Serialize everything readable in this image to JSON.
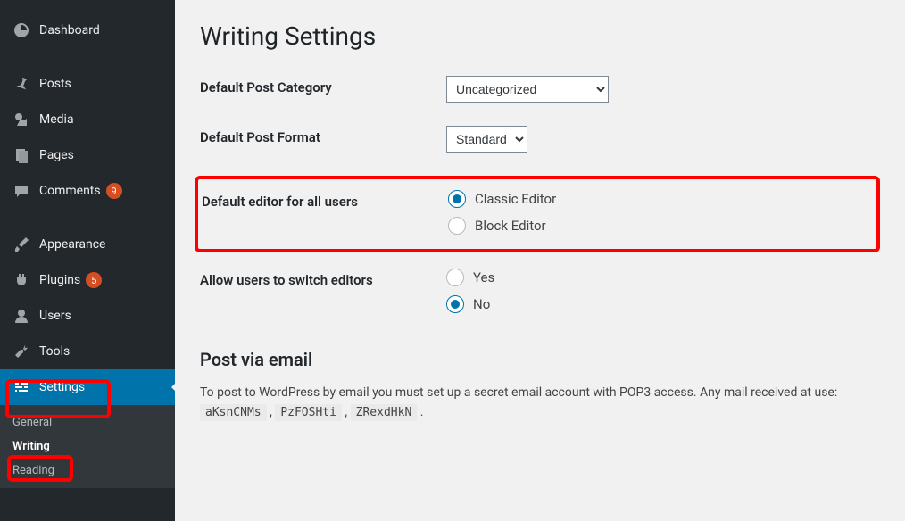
{
  "sidebar": {
    "items": [
      {
        "label": "Dashboard"
      },
      {
        "label": "Posts"
      },
      {
        "label": "Media"
      },
      {
        "label": "Pages"
      },
      {
        "label": "Comments",
        "badge": "9"
      },
      {
        "label": "Appearance"
      },
      {
        "label": "Plugins",
        "badge": "5"
      },
      {
        "label": "Users"
      },
      {
        "label": "Tools"
      },
      {
        "label": "Settings"
      }
    ],
    "submenu": [
      {
        "label": "General"
      },
      {
        "label": "Writing"
      },
      {
        "label": "Reading"
      }
    ]
  },
  "page": {
    "title": "Writing Settings",
    "post_category_label": "Default Post Category",
    "post_category_value": "Uncategorized",
    "post_format_label": "Default Post Format",
    "post_format_value": "Standard",
    "default_editor_label": "Default editor for all users",
    "editor_classic": "Classic Editor",
    "editor_block": "Block Editor",
    "allow_switch_label": "Allow users to switch editors",
    "yes": "Yes",
    "no": "No",
    "post_via_email_title": "Post via email",
    "post_via_email_desc": "To post to WordPress by email you must set up a secret email account with POP3 access. Any mail received at use: ",
    "codes": [
      "aKsnCNMs",
      "PzFOSHti",
      "ZRexdHkN"
    ]
  }
}
